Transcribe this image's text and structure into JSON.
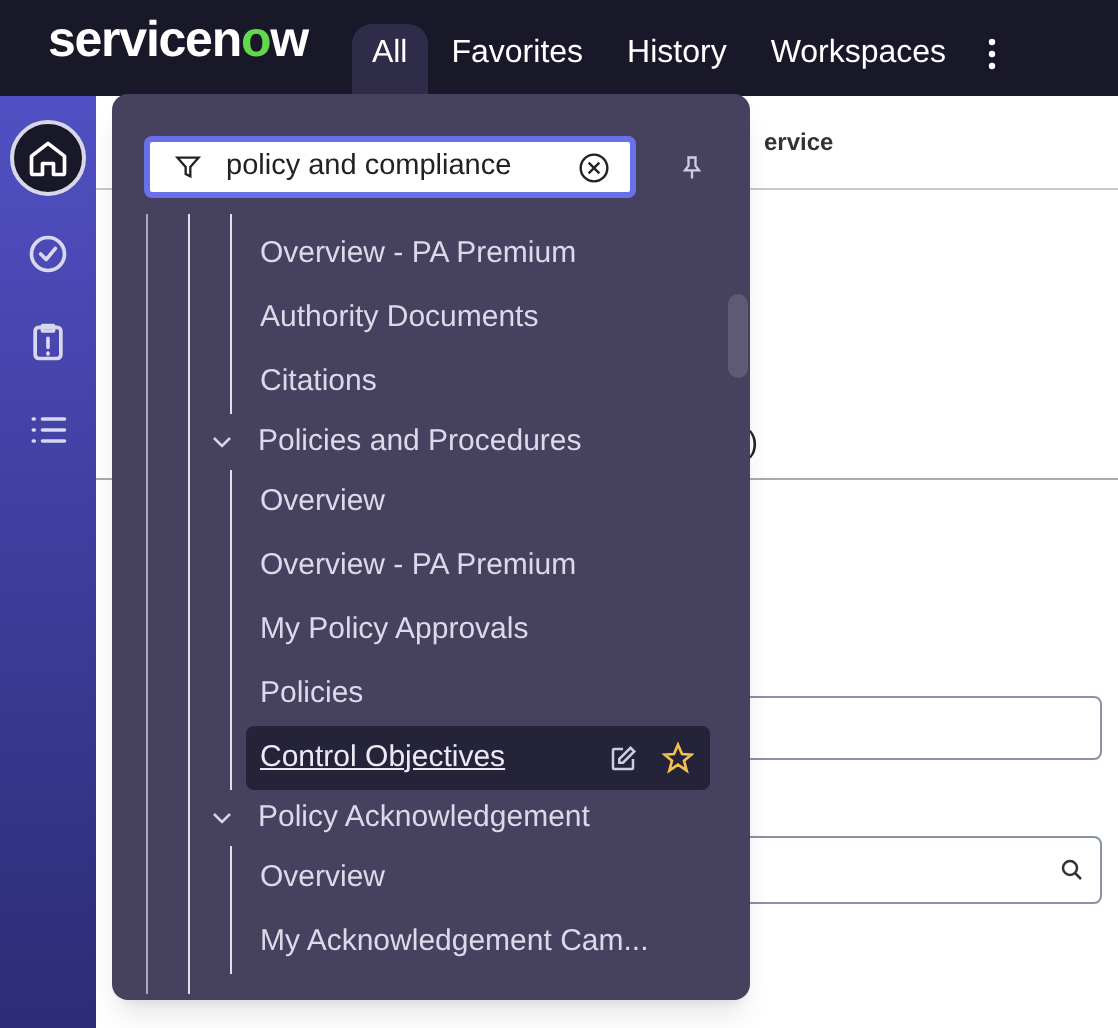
{
  "header": {
    "logo": {
      "left": "servicen",
      "accent": "o",
      "right": "w"
    },
    "tabs": [
      {
        "label": "All",
        "selected": true
      },
      {
        "label": "Favorites",
        "selected": false
      },
      {
        "label": "History",
        "selected": false
      },
      {
        "label": "Workspaces",
        "selected": false
      }
    ]
  },
  "rail": [
    {
      "kind": "home",
      "selected": true
    },
    {
      "kind": "check",
      "selected": false
    },
    {
      "kind": "clipboard",
      "selected": false
    },
    {
      "kind": "list",
      "selected": false
    }
  ],
  "background": {
    "heading": "ervice",
    "note": ")"
  },
  "menu": {
    "filter": {
      "value": "policy and compliance"
    },
    "sections": [
      {
        "children": [
          {
            "label": "Overview - PA Premium",
            "selected": false
          },
          {
            "label": "Authority Documents",
            "selected": false
          },
          {
            "label": "Citations",
            "selected": false
          }
        ]
      },
      {
        "label": "Policies and Procedures",
        "expanded": true,
        "children": [
          {
            "label": "Overview",
            "selected": false
          },
          {
            "label": "Overview - PA Premium",
            "selected": false
          },
          {
            "label": "My Policy Approvals",
            "selected": false
          },
          {
            "label": "Policies",
            "selected": false
          },
          {
            "label": "Control Objectives",
            "selected": true
          }
        ]
      },
      {
        "label": "Policy Acknowledgement",
        "expanded": true,
        "children": [
          {
            "label": "Overview",
            "selected": false
          },
          {
            "label": "My Acknowledgement Cam...",
            "selected": false
          }
        ]
      }
    ]
  }
}
